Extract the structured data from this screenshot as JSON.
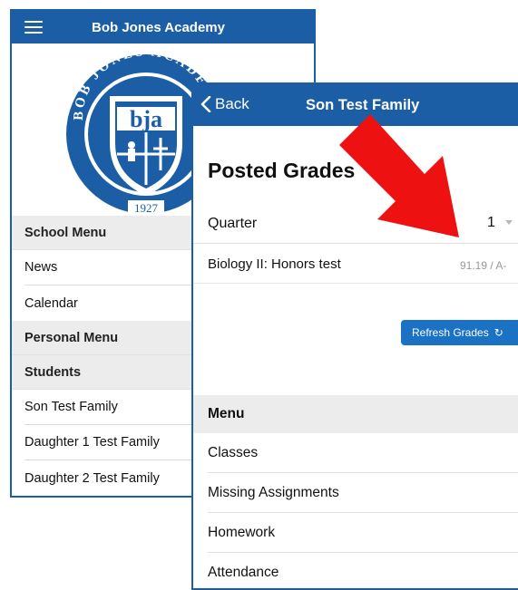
{
  "left": {
    "header_title": "Bob Jones Academy",
    "logo": {
      "ring_text": "BOB JONES ACADEMY",
      "monogram": "bja",
      "year": "1927"
    },
    "sections": [
      {
        "label": "School Menu",
        "items": [
          "News",
          "Calendar"
        ]
      },
      {
        "label": "Personal Menu",
        "items": []
      },
      {
        "label": "Students",
        "items": [
          "Son Test Family",
          "Daughter 1 Test Family",
          "Daughter 2 Test Family"
        ]
      }
    ]
  },
  "right": {
    "back_label": "Back",
    "header_title": "Son Test Family",
    "page_title": "Posted Grades",
    "quarter": {
      "label": "Quarter",
      "value": "1"
    },
    "grade": {
      "course": "Biology II: Honors test",
      "score": "91.19 / A-"
    },
    "refresh_label": "Refresh Grades",
    "menu": {
      "label": "Menu",
      "items": [
        "Classes",
        "Missing Assignments",
        "Homework",
        "Attendance"
      ]
    }
  },
  "colors": {
    "brand_blue": "#1b5ea5",
    "button_blue": "#1b72c4",
    "arrow_red": "#ee1111",
    "section_gray": "#ececec"
  },
  "icons": {
    "menu": "hamburger-icon",
    "back": "chevron-left-icon",
    "refresh": "refresh-icon",
    "select": "caret-down-icon",
    "annotation": "red-arrow"
  }
}
